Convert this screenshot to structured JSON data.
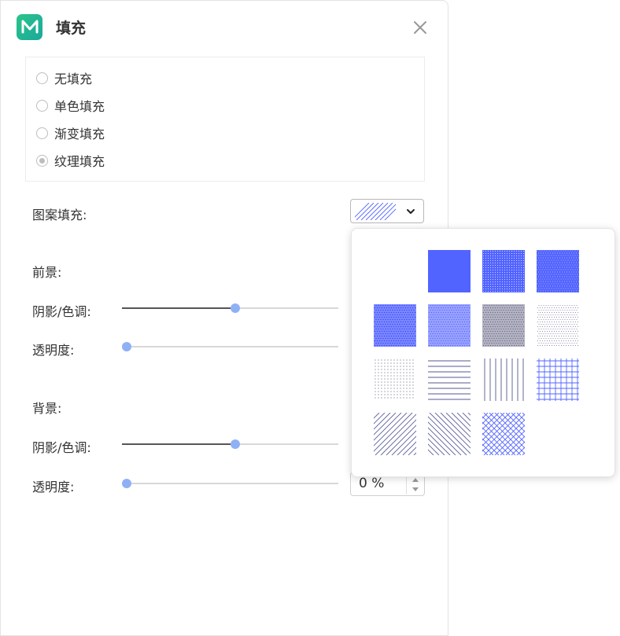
{
  "dialog": {
    "title": "填充",
    "logo_icon": "mindmaster-logo-icon",
    "close_icon": "close-icon"
  },
  "fill_options": [
    {
      "label": "无填充",
      "checked": false
    },
    {
      "label": "单色填充",
      "checked": false
    },
    {
      "label": "渐变填充",
      "checked": false
    },
    {
      "label": "纹理填充",
      "checked": true
    }
  ],
  "pattern_fill": {
    "label": "图案填充:",
    "selected_pattern": "diagonal-lines-wide",
    "dropdown_icon": "chevron-down-icon"
  },
  "foreground": {
    "heading": "前景:",
    "shade_label": "阴影/色调:",
    "shade_value": 0.5,
    "opacity_label": "透明度:",
    "opacity_value": 0
  },
  "background": {
    "heading": "背景:",
    "shade_label": "阴影/色调:",
    "shade_value": 0.5,
    "opacity_label": "透明度:",
    "opacity_value": 0,
    "opacity_display": "0 %"
  },
  "pattern_popup": {
    "color": "#5264ff",
    "patterns": [
      "none",
      "solid",
      "dots-dense",
      "dots-heavy",
      "dots-medium",
      "dots-mid",
      "dots-light",
      "dots-sparse",
      "dots-fine",
      "horizontal-lines",
      "vertical-lines",
      "grid",
      "diagonal-lines-wide",
      "diagonal-lines-back",
      "diagonal-cross"
    ],
    "selected": "diagonal-lines-wide"
  }
}
